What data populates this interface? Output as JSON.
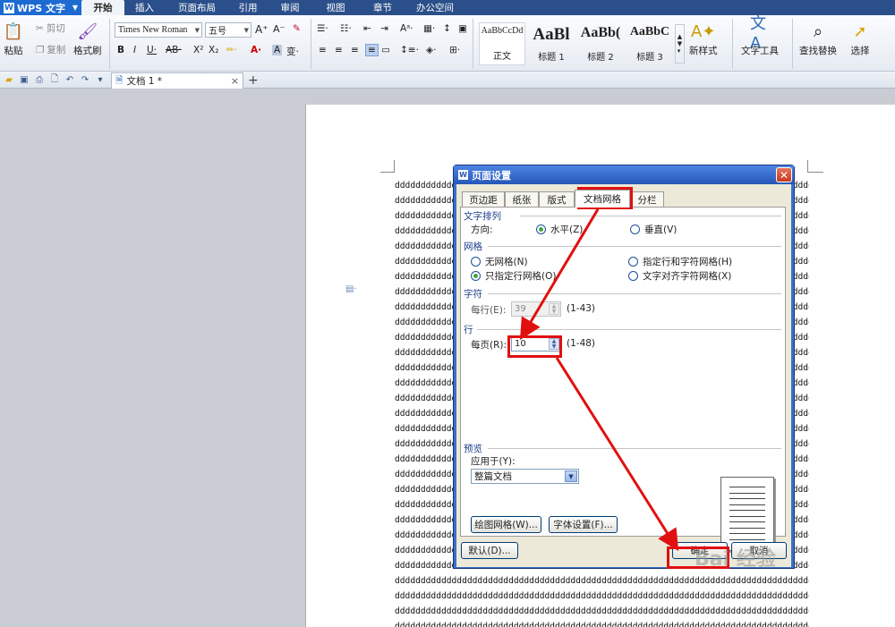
{
  "app": {
    "name": "WPS 文字",
    "logo": "W"
  },
  "menu_tabs": [
    "开始",
    "插入",
    "页面布局",
    "引用",
    "审阅",
    "视图",
    "章节",
    "办公空间"
  ],
  "active_menu_tab": "开始",
  "ribbon": {
    "paste": "粘贴",
    "cut": "剪切",
    "copy": "复制",
    "format_painter": "格式刷",
    "font_name": "Times New Roman",
    "font_size": "五号",
    "styles": [
      {
        "sample": "AaBbCcDd",
        "name": "正文"
      },
      {
        "sample": "AaBl",
        "name": "标题 1"
      },
      {
        "sample": "AaBb(",
        "name": "标题 2"
      },
      {
        "sample": "AaBbC",
        "name": "标题 3"
      }
    ],
    "new_style": "新样式",
    "text_tools": "文字工具",
    "find_replace": "查找替换",
    "select": "选择"
  },
  "document_tab": {
    "title": "文档 1 *",
    "close": "×"
  },
  "document_line_text": "dddddddddddddddddddddddddddddddddddddddddddddddddddddddddddddddddddddddddddddddddd",
  "dialog": {
    "title": "页面设置",
    "tabs": [
      "页边距",
      "纸张",
      "版式",
      "文档网格",
      "分栏"
    ],
    "active_tab": "文档网格",
    "text_direction": {
      "group": "文字排列",
      "label": "方向:",
      "options": [
        "水平(Z)",
        "垂直(V)"
      ],
      "selected": "水平(Z)"
    },
    "grid": {
      "group": "网格",
      "options": [
        "无网格(N)",
        "指定行和字符网格(H)",
        "只指定行网格(O)",
        "文字对齐字符网格(X)"
      ],
      "selected": "只指定行网格(O)"
    },
    "characters": {
      "group": "字符",
      "label": "每行(E):",
      "value": "39",
      "range": "(1-43)",
      "disabled": true
    },
    "lines": {
      "group": "行",
      "label": "每页(R):",
      "value": "10",
      "range": "(1-48)"
    },
    "preview": {
      "group": "预览",
      "apply_label": "应用于(Y):",
      "apply_value": "整篇文档"
    },
    "buttons": {
      "draw_grid": "绘图网格(W)...",
      "font_settings": "字体设置(F)...",
      "default": "默认(D)...",
      "ok": "确定",
      "cancel": "取消"
    }
  },
  "watermark": "Bai 经验",
  "colors": {
    "annotation": "#e01010",
    "title_bar": "#2657b8",
    "menu_bar": "#2a4f8a"
  }
}
